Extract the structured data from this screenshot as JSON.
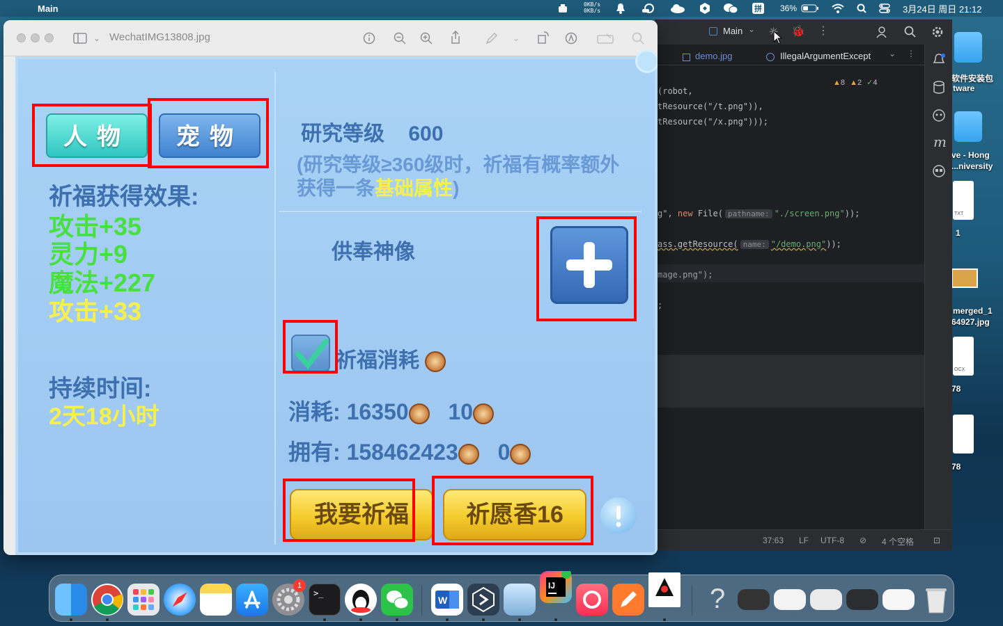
{
  "menubar": {
    "app_name": "Main",
    "net_up": "0KB/s",
    "net_down": "0KB/s",
    "battery": "36%",
    "datetime": "3月24日 周日 21:12",
    "input_method": "拼"
  },
  "ide": {
    "run_config": "Main",
    "tabs": [
      "demo.jpg",
      "IllegalArgumentExcept"
    ],
    "inspections": {
      "warnings": "8",
      "weak": "2",
      "ok": "4"
    },
    "code": {
      "l1": "(robot,",
      "l2": "tResource(\"/t.png\")),",
      "l3": "tResource(\"/x.png\")));",
      "l4_a": "g\", ",
      "l4_kw": "new",
      "l4_b": " File(",
      "l4_hint": "pathname:",
      "l4_str": "\"./screen.png\"",
      "l4_c": "));",
      "l5_a": "ass.getResource(",
      "l5_hint": "name:",
      "l5_str": "\"/demo.png\"",
      "l5_c": "));",
      "l6": "mage.png\");",
      "l7": ";"
    },
    "status": {
      "position": "37:63",
      "line_ending": "LF",
      "encoding": "UTF-8",
      "indent": "4 个空格"
    }
  },
  "preview": {
    "title": "WechatIMG13808.jpg"
  },
  "game": {
    "tab_character": "人物",
    "tab_pet": "宠物",
    "effect_title": "祈福获得效果:",
    "effects": [
      "攻击+35",
      "灵力+9",
      "魔法+227",
      "攻击+33"
    ],
    "duration_label": "持续时间:",
    "duration_value": "2天18小时",
    "research_label": "研究等级",
    "research_value": "600",
    "note_line1": "(研究等级≥360级时，祈福有概率额外",
    "note_line2_a": "获得一条",
    "note_line2_hl": "基础属性",
    "note_line2_b": ")",
    "offering_label": "供奉神像",
    "consume_label": "祈福消耗",
    "cost_label": "消耗:",
    "cost_coins": "16350",
    "cost_tokens": "10",
    "own_label": "拥有:",
    "own_coins": "158462423",
    "own_tokens": "0",
    "pray_button": "我要祈福",
    "incense_button": "祈愿香16"
  },
  "desktop": {
    "labels": [
      "软件安装包",
      "tware",
      "ve - Hong",
      "...niversity",
      "1",
      "merged_1",
      "64927.jpg",
      "78",
      "78"
    ],
    "doc_ext": [
      "TXT",
      "OCX"
    ]
  },
  "dock": {
    "badge_settings": "1",
    "icons": [
      "finder-icon",
      "chrome-icon",
      "launchpad-icon",
      "safari-icon",
      "notes-icon",
      "app-store-icon",
      "system-settings-icon",
      "terminal-icon",
      "qq-icon",
      "wechat-icon",
      "word-icon",
      "remote-desktop-icon",
      "preview-icon",
      "intellij-icon",
      "music-app-icon",
      "pen-app-icon",
      "java-icon",
      "help-icon",
      "trash-icon"
    ]
  },
  "colors": {
    "highlight_red": "#ff0000",
    "effect_green": "#48e040",
    "effect_yellow": "#f5f050",
    "game_text_blue": "#3e6fae"
  }
}
